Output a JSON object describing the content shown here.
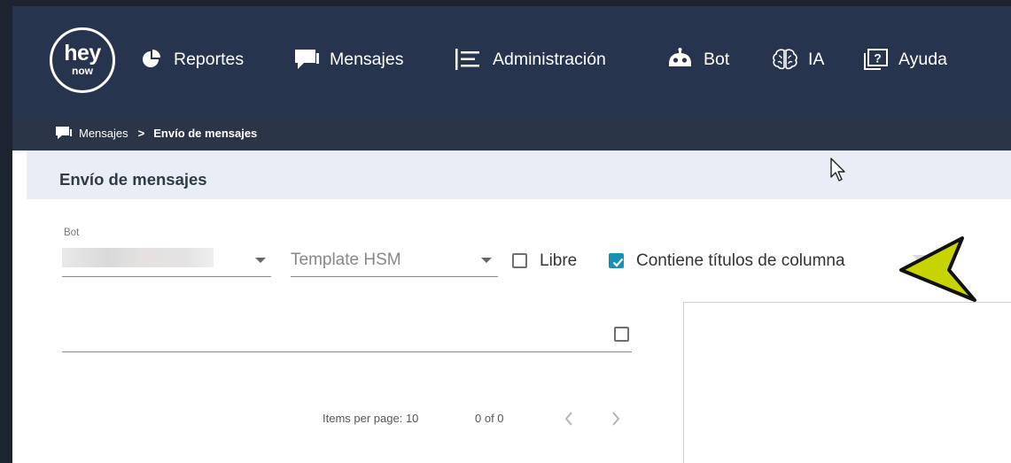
{
  "logo": {
    "line1": "hey",
    "line2": "now"
  },
  "nav": {
    "items": [
      {
        "label": "Reportes",
        "icon": "pie-chart-icon"
      },
      {
        "label": "Mensajes",
        "icon": "chat-bubble-icon"
      },
      {
        "label": "Administración",
        "icon": "list-admin-icon"
      },
      {
        "label": "Bot",
        "icon": "robot-icon"
      },
      {
        "label": "IA",
        "icon": "brain-icon"
      },
      {
        "label": "Ayuda",
        "icon": "help-icon"
      }
    ]
  },
  "breadcrumb": {
    "parent": "Mensajes",
    "separator": ">",
    "current": "Envío de mensajes",
    "icon": "chat-bubble-icon"
  },
  "page": {
    "title": "Envío de mensajes"
  },
  "form": {
    "bot_label": "Bot",
    "template_placeholder": "Template HSM",
    "libre_label": "Libre",
    "libre_checked": false,
    "column_titles_label": "Contiene títulos de columna",
    "column_titles_checked": true
  },
  "paginator": {
    "items_per_page_label": "Items per page:",
    "page_size": "10",
    "range": "0 of 0"
  },
  "colors": {
    "topbar": "#26344d",
    "breadcrumb_bar": "#2a3548",
    "title_bar": "#e9eef6",
    "checkbox_accent": "#1b8fb3",
    "pointer_arrow": "#c8d400"
  },
  "icons": [
    "pie-chart-icon",
    "chat-bubble-icon",
    "list-admin-icon",
    "robot-icon",
    "brain-icon",
    "help-icon",
    "chevron-left-icon",
    "chevron-right-icon",
    "cursor-icon",
    "pointer-arrow-icon"
  ]
}
